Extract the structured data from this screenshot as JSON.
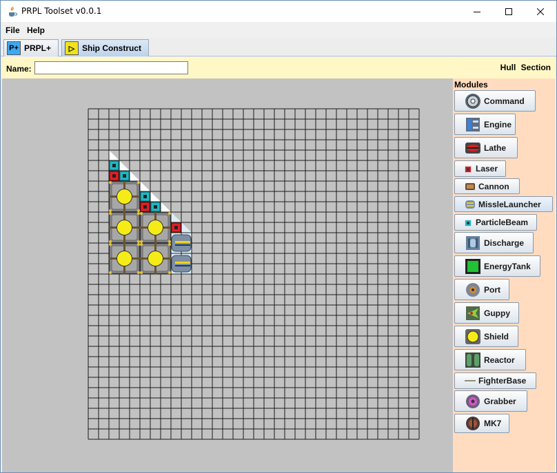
{
  "window": {
    "title": "PRPL Toolset v0.0.1",
    "icon": "java-coffee-icon"
  },
  "menu": {
    "file": "File",
    "help": "Help"
  },
  "tabs": [
    {
      "label": "PRPL+",
      "icon_text": "P+",
      "icon_color": "#3ea8f0"
    },
    {
      "label": "Ship Construct",
      "icon_text": "▷",
      "icon_color": "#f2e21a",
      "active": true
    }
  ],
  "toolbar": {
    "name_label": "Name:",
    "name_value": "",
    "hull_section": "Hull Section"
  },
  "modules": {
    "title": "Modules",
    "items": [
      {
        "label": "Command",
        "icon": "command-icon"
      },
      {
        "label": "Engine",
        "icon": "engine-icon"
      },
      {
        "label": "Lathe",
        "icon": "lathe-icon"
      },
      {
        "label": "Laser",
        "icon": "laser-icon"
      },
      {
        "label": "Cannon",
        "icon": "cannon-icon"
      },
      {
        "label": "MissleLauncher",
        "icon": "missile-launcher-icon"
      },
      {
        "label": "ParticleBeam",
        "icon": "particle-beam-icon"
      },
      {
        "label": "Discharge",
        "icon": "discharge-icon"
      },
      {
        "label": "EnergyTank",
        "icon": "energy-tank-icon"
      },
      {
        "label": "Port",
        "icon": "port-icon"
      },
      {
        "label": "Guppy",
        "icon": "guppy-icon"
      },
      {
        "label": "Shield",
        "icon": "shield-icon"
      },
      {
        "label": "Reactor",
        "icon": "reactor-icon"
      },
      {
        "label": "FighterBase",
        "icon": "fighter-base-icon"
      },
      {
        "label": "Grabber",
        "icon": "grabber-icon"
      },
      {
        "label": "MK7",
        "icon": "mk7-icon"
      }
    ]
  },
  "ship_grid": {
    "columns": 32,
    "rows": 32,
    "hull_color": "#ffffff",
    "hull_edge_color": "#cfe6f5",
    "placed_modules": [
      {
        "type": "ParticleBeam",
        "col": 2,
        "row": 5
      },
      {
        "type": "ParticleBeam",
        "col": 3,
        "row": 6
      },
      {
        "type": "Laser",
        "col": 2,
        "row": 6
      },
      {
        "type": "ParticleBeam",
        "col": 5,
        "row": 8
      },
      {
        "type": "ParticleBeam",
        "col": 6,
        "row": 9
      },
      {
        "type": "Laser",
        "col": 5,
        "row": 9
      },
      {
        "type": "Laser",
        "col": 8,
        "row": 11
      },
      {
        "type": "Shield",
        "col": 2,
        "row": 7
      },
      {
        "type": "Shield",
        "col": 2,
        "row": 10
      },
      {
        "type": "Shield",
        "col": 5,
        "row": 10
      },
      {
        "type": "Shield",
        "col": 2,
        "row": 13
      },
      {
        "type": "Shield",
        "col": 5,
        "row": 13
      },
      {
        "type": "MissleLauncher",
        "col": 8,
        "row": 12
      },
      {
        "type": "MissleLauncher",
        "col": 8,
        "row": 14
      }
    ]
  }
}
